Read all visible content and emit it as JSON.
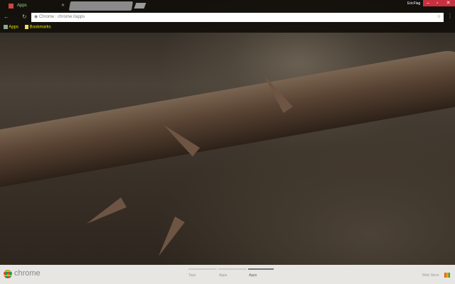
{
  "tabs": [
    {
      "label": "Apps",
      "active": true
    },
    {
      "label": "",
      "active": false
    }
  ],
  "toolbar": {
    "security_chip": "Chrome",
    "url": "chrome://apps"
  },
  "bookmarks": [
    {
      "label": "Apps"
    },
    {
      "label": "Bookmarks"
    }
  ],
  "profile": "EricFlag",
  "footer": {
    "logo": "chrome",
    "pages": [
      "Tops",
      "Apps",
      "Apps"
    ],
    "webstore": "Web Store"
  },
  "colors": {
    "accent": "#c83040",
    "bookmark_text": "#e8e800"
  }
}
